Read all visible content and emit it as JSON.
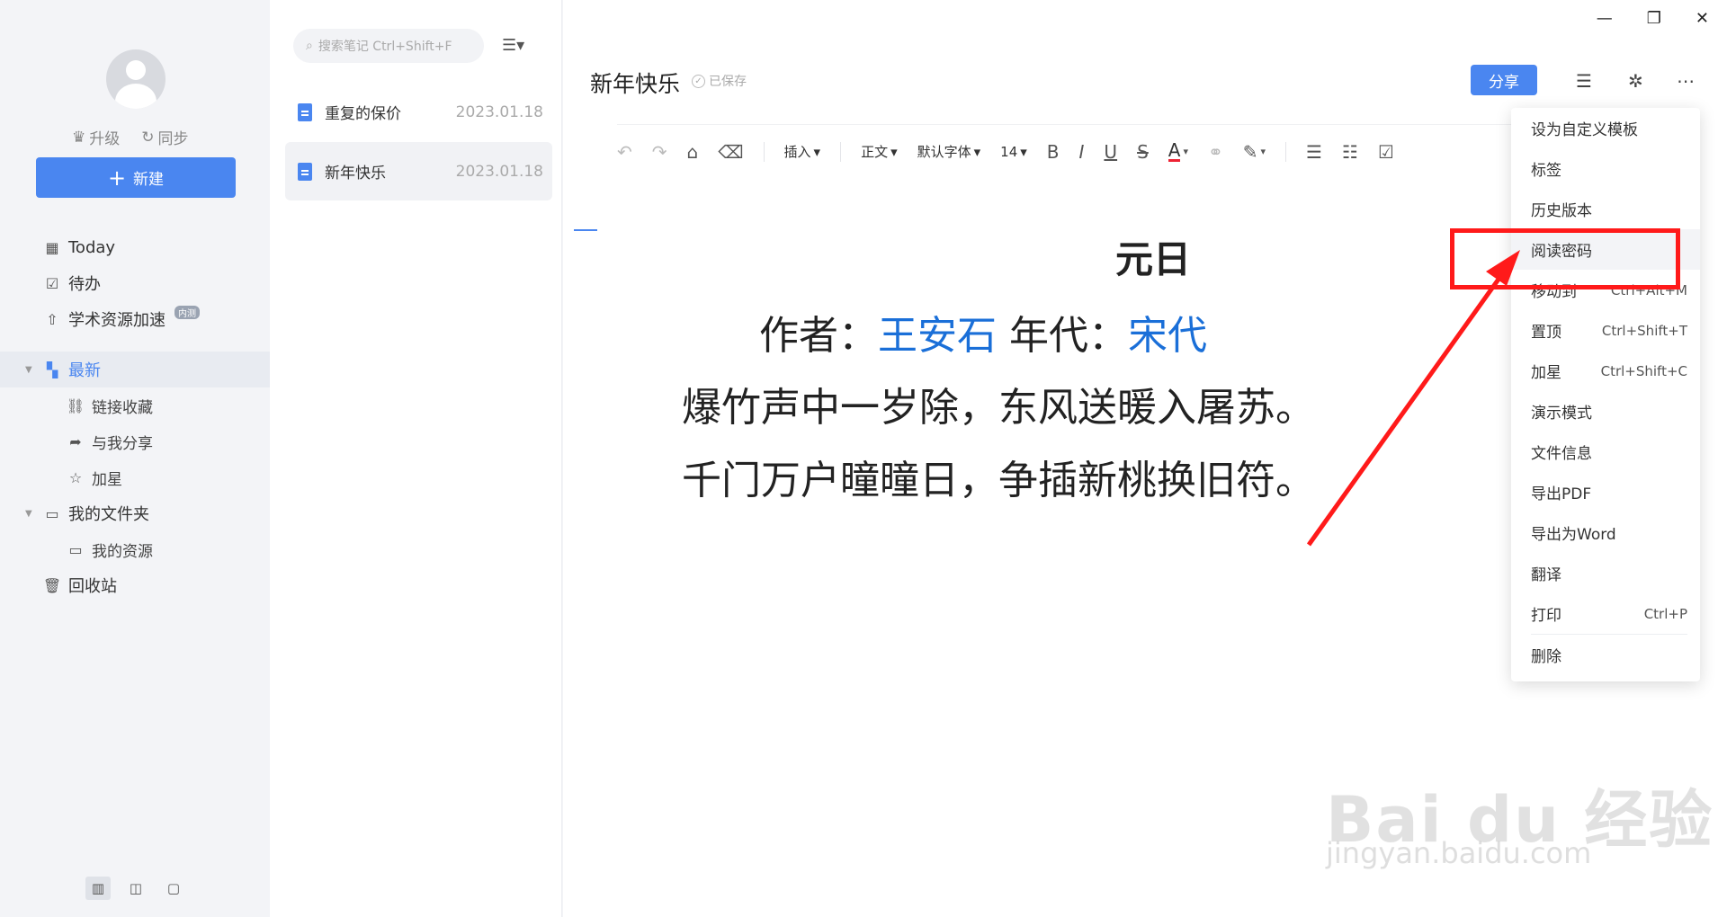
{
  "sidebar": {
    "upgrade": "升级",
    "sync": "同步",
    "new_button": "新建",
    "nav": [
      {
        "label": "Today",
        "icon": "calendar-icon"
      },
      {
        "label": "待办",
        "icon": "checkbox-icon"
      },
      {
        "label": "学术资源加速",
        "icon": "rocket-icon",
        "badge": "内测"
      }
    ],
    "latest": "最新",
    "latest_children": [
      "链接收藏",
      "与我分享",
      "加星"
    ],
    "my_folder": "我的文件夹",
    "my_folder_children": [
      "我的资源"
    ],
    "trash": "回收站"
  },
  "notelist": {
    "search_placeholder": "搜索笔记 Ctrl+Shift+F",
    "notes": [
      {
        "title": "重复的保价",
        "date": "2023.01.18"
      },
      {
        "title": "新年快乐",
        "date": "2023.01.18"
      }
    ]
  },
  "editor": {
    "title": "新年快乐",
    "saved": "已保存",
    "share": "分享",
    "toolbar": {
      "insert": "插入",
      "style": "正文",
      "font": "默认字体",
      "size": "14"
    },
    "poem": {
      "title": "元日",
      "author_label": "作者：",
      "author": "王安石",
      "era_label": "年代：",
      "era": "宋代",
      "line1": "爆竹声中一岁除，东风送暖入屠苏。",
      "line2": "千门万户曈曈日，争插新桃换旧符。"
    }
  },
  "menu": {
    "items": [
      {
        "label": "设为自定义模板",
        "shortcut": ""
      },
      {
        "label": "标签",
        "shortcut": ""
      },
      {
        "label": "历史版本",
        "shortcut": ""
      },
      {
        "label": "阅读密码",
        "shortcut": ""
      },
      {
        "label": "移动到",
        "shortcut": "Ctrl+Alt+M"
      },
      {
        "label": "置顶",
        "shortcut": "Ctrl+Shift+T"
      },
      {
        "label": "加星",
        "shortcut": "Ctrl+Shift+C"
      },
      {
        "label": "演示模式",
        "shortcut": ""
      },
      {
        "label": "文件信息",
        "shortcut": ""
      },
      {
        "label": "导出PDF",
        "shortcut": ""
      },
      {
        "label": "导出为Word",
        "shortcut": ""
      },
      {
        "label": "翻译",
        "shortcut": ""
      },
      {
        "label": "打印",
        "shortcut": "Ctrl+P"
      },
      {
        "label": "删除",
        "shortcut": ""
      }
    ]
  },
  "watermark": {
    "main": "Bai du 经验",
    "sub": "jingyan.baidu.com"
  },
  "colors": {
    "accent": "#4a86f0",
    "highlight": "#ff1a1a",
    "link": "#1a6fd8"
  }
}
